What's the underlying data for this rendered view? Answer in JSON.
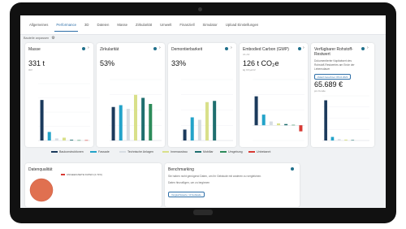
{
  "tabs": [
    {
      "label": "Allgemeines"
    },
    {
      "label": "Performance"
    },
    {
      "label": "3D"
    },
    {
      "label": "Dateien"
    },
    {
      "label": "Masse"
    },
    {
      "label": "Zirkularität"
    },
    {
      "label": "Umwelt"
    },
    {
      "label": "Finanziell"
    },
    {
      "label": "Simulator"
    },
    {
      "label": "Upload Einstellungen"
    }
  ],
  "active_tab": "Performance",
  "subbar": {
    "label": "Bauteile anpassen"
  },
  "colors": {
    "Bauunterhaltung": "#1b3a5c",
    "Fassade": "#23a3c9",
    "Technische Anlagen": "#d7dde3",
    "Innenausbau": "#d9e08a",
    "Mobiliar": "#1f6f6f",
    "Umgebung": "#2d8b5a",
    "Unbekannt": "#d83a34"
  },
  "legend": [
    {
      "label": "Baukonstruktionen",
      "color": "#1b3a5c"
    },
    {
      "label": "Fassade",
      "color": "#23a3c9"
    },
    {
      "label": "Technische Anlagen",
      "color": "#d7dde3"
    },
    {
      "label": "Innenausbau",
      "color": "#d9e08a"
    },
    {
      "label": "Mobiliar",
      "color": "#1f6f6f"
    },
    {
      "label": "Umgebung",
      "color": "#2d8b5a"
    },
    {
      "label": "Unbekannt",
      "color": "#d83a34"
    }
  ],
  "cards": {
    "masse": {
      "title": "Masse",
      "value": "331 t",
      "unit": "t/m²"
    },
    "zirk": {
      "title": "Zirkularität",
      "value": "53%"
    },
    "demont": {
      "title": "Demontierbarkeit",
      "value": "33%"
    },
    "carbon": {
      "title": "Embodied Carbon (GWP)",
      "sub": "A1-A3",
      "value": "126 t CO₂e",
      "unit": "kg CO₂e/m²"
    },
    "rohstoff": {
      "title_line1": "Verfügbarer Rohstoff-",
      "title_line2": "Restwert",
      "note_line1": "Dokumentierter Kapitalwert des",
      "note_line2": "Rohstoff-Restwertes am Ende der",
      "note_line3": "Lebensdauer",
      "pill": "Zuletzt berechnet: 05.10.2023",
      "value": "65.689 €",
      "unit": "pro Kunde"
    },
    "daten": {
      "title": "Datenqualität",
      "legend_label": "UNGEEIGNETE DATEN (2.72%)"
    },
    "bench": {
      "title": "Benchmarking",
      "note_line1": "Sie haben nicht genügend Daten, um Ihr Gebäude mit anderen zu vergleichen.",
      "note_line2": "Daten hinzufügen, um zu beginnen",
      "pill": "Vergleichswerte: 13 Gebäude"
    }
  },
  "chart_data": [
    {
      "type": "bar",
      "title": "Masse",
      "ylabel": "kg/m²",
      "categories": [
        "Baukonstruktionen",
        "Fassade",
        "Technische Anlagen",
        "Innenausbau",
        "Mobiliar",
        "Umgebung",
        "Unbekannt"
      ],
      "values": [
        570,
        120,
        30,
        40,
        10,
        5,
        5
      ],
      "ylim": [
        0,
        800
      ]
    },
    {
      "type": "bar",
      "title": "Zirkularität",
      "categories": [
        "Baukonstruktionen",
        "Fassade",
        "Technische Anlagen",
        "Innenausbau",
        "Mobiliar",
        "Umgebung",
        "Unbekannt"
      ],
      "values": [
        55,
        58,
        52,
        75,
        70,
        60,
        0
      ],
      "ylim": [
        0,
        100
      ]
    },
    {
      "type": "bar",
      "title": "Demontierbarkeit",
      "categories": [
        "Baukonstruktionen",
        "Fassade",
        "Technische Anlagen",
        "Innenausbau",
        "Mobiliar",
        "Umgebung",
        "Unbekannt"
      ],
      "values": [
        18,
        38,
        34,
        63,
        65,
        0,
        0
      ],
      "ylim": [
        0,
        100
      ]
    },
    {
      "type": "bar",
      "title": "Embodied Carbon (GWP)",
      "ylabel": "kg CO₂e/m²",
      "categories": [
        "Baukonstruktionen",
        "Fassade",
        "Technische Anlagen",
        "Innenausbau",
        "Mobiliar",
        "Umgebung",
        "Unbekannt"
      ],
      "values": [
        190,
        70,
        25,
        12,
        8,
        3,
        -40
      ],
      "ylim": [
        -100,
        300
      ]
    },
    {
      "type": "bar",
      "title": "Verfügbarer Rohstoff-Restwert",
      "categories": [
        "Baukonstruktionen",
        "Fassade",
        "Technische Anlagen",
        "Innenausbau",
        "Mobiliar",
        "Umgebung",
        "Unbekannt"
      ],
      "values": [
        90,
        8,
        3,
        2,
        1,
        0,
        0
      ],
      "ylim": [
        0,
        100
      ]
    },
    {
      "type": "pie",
      "title": "Datenqualität",
      "categories": [
        "UNGEEIGNETE DATEN (2.72%)"
      ],
      "values": [
        100
      ]
    }
  ]
}
